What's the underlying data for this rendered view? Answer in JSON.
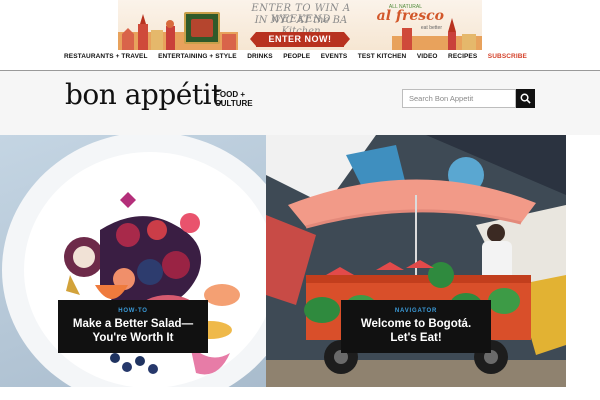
{
  "ad": {
    "line1": "ENTER TO WIN A WEEKEND",
    "line2": "IN NYC AT the BA Kitchen",
    "cta": "ENTER NOW!",
    "brand": "al fresco",
    "brand_small": "ALL NATURAL",
    "brand_sub": "eat better"
  },
  "nav": {
    "items": [
      "RESTAURANTS + TRAVEL",
      "ENTERTAINING + STYLE",
      "DRINKS",
      "PEOPLE",
      "EVENTS",
      "TEST KITCHEN",
      "VIDEO",
      "RECIPES"
    ],
    "subscribe": "SUBSCRIBE"
  },
  "masthead": {
    "logo": "bon appétit",
    "tagline_line1": "FOOD +",
    "tagline_line2": "CULTURE",
    "search_placeholder": "Search Bon Appetit"
  },
  "cards": [
    {
      "tag": "HOW-TO",
      "title": "Make a Better Salad— You're Worth It"
    },
    {
      "tag": "NAVIGATOR",
      "title": "Welcome to Bogotá. Let's Eat!"
    }
  ],
  "colors": {
    "accent_red": "#d4422b",
    "tag_blue": "#3b9bd9",
    "caption_bg": "#111111"
  }
}
